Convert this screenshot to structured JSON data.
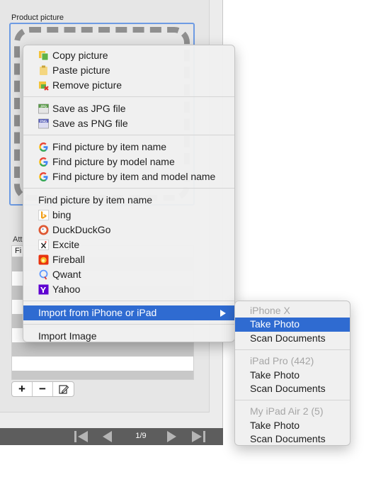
{
  "window": {
    "product_label": "Product picture",
    "attr_label": "Att",
    "attr_header": "Fi",
    "page_counter": "1/9"
  },
  "toolbar": {
    "add_label": "+",
    "remove_label": "−"
  },
  "menu": {
    "copy": "Copy picture",
    "paste": "Paste picture",
    "remove": "Remove picture",
    "save_jpg": "Save as JPG file",
    "save_png": "Save as PNG file",
    "jpg_tag": "JPG",
    "png_tag": "PNG",
    "find_item": "Find picture by item name",
    "find_model": "Find picture by model name",
    "find_both": "Find picture by item and model name",
    "find_header": "Find picture by item name",
    "engines": [
      "bing",
      "DuckDuckGo",
      "Excite",
      "Fireball",
      "Qwant",
      "Yahoo"
    ],
    "import_iphone": "Import from iPhone or iPad",
    "import_image": "Import Image"
  },
  "submenu": {
    "devices": [
      {
        "name": "iPhone X",
        "actions": [
          "Take Photo",
          "Scan Documents"
        ]
      },
      {
        "name": "iPad Pro (442)",
        "actions": [
          "Take Photo",
          "Scan Documents"
        ]
      },
      {
        "name": "My iPad Air 2 (5)",
        "actions": [
          "Take Photo",
          "Scan Documents"
        ]
      }
    ]
  },
  "colors": {
    "selection": "#2f6bd1",
    "focus_ring": "#6d9be3"
  }
}
